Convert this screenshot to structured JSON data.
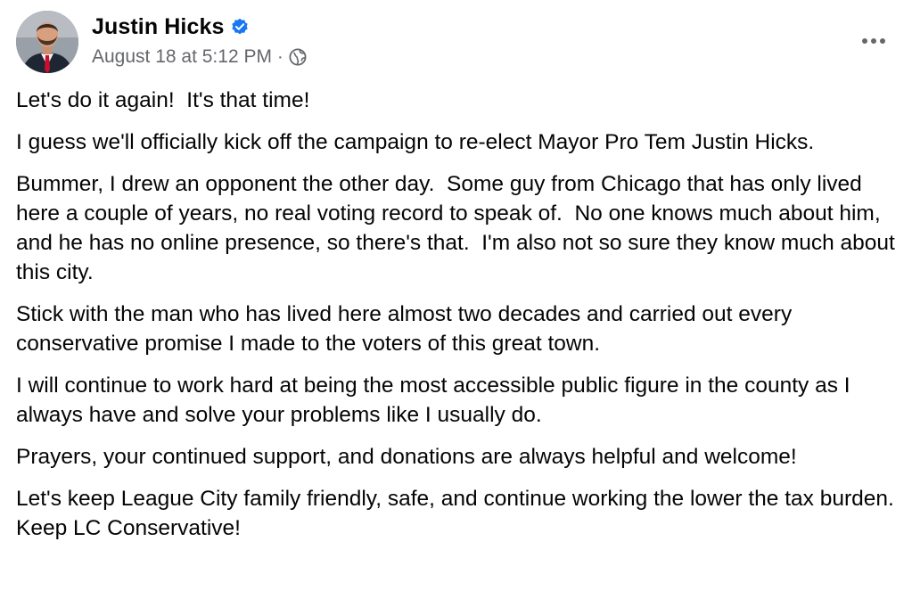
{
  "post": {
    "author": {
      "name": "Justin Hicks",
      "verified": true,
      "avatar_icon": "person-portrait"
    },
    "timestamp": "August 18 at 5:12 PM",
    "separator": "·",
    "audience_icon": "globe-icon",
    "more_icon": "more-options-icon",
    "paragraphs": [
      "Let's do it again!  It's that time!",
      "I guess we'll officially kick off the campaign to re-elect Mayor Pro Tem Justin Hicks.",
      "Bummer, I drew an opponent the other day.  Some guy from Chicago that has only lived here a couple of years, no real voting record to speak of.  No one knows much about him, and he has no online presence, so there's that.  I'm also not so sure they know much about this city.",
      "Stick with the man who has lived here almost two decades and carried out every conservative promise I made to the voters of this great town.",
      "I will continue to work hard at being the most accessible public figure in the county as I always have and solve your problems like I usually do.",
      "Prayers, your continued support, and donations are always helpful and welcome!",
      "Let's keep League City family friendly, safe, and continue working the lower the tax burden.  Keep LC Conservative!"
    ]
  },
  "colors": {
    "text_primary": "#050505",
    "text_secondary": "#65676b",
    "verified_blue": "#1877f2",
    "background": "#ffffff"
  }
}
